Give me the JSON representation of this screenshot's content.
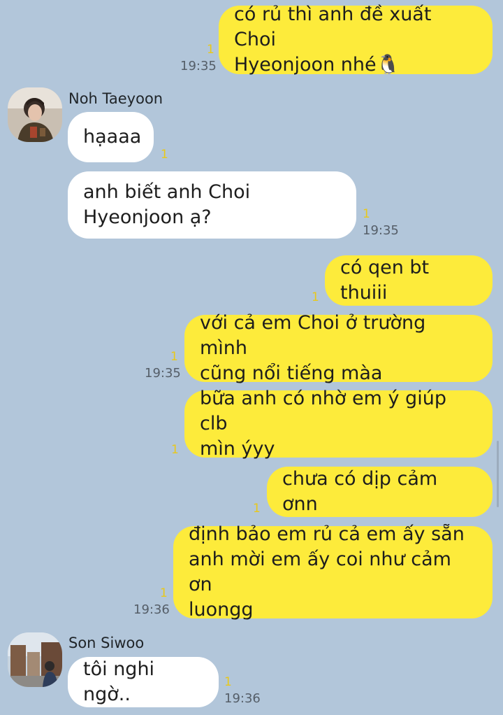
{
  "colors": {
    "background": "#b2c6da",
    "outgoing_bubble": "#fdeb3b",
    "incoming_bubble": "#ffffff",
    "read_count": "#e8c81a"
  },
  "messages": [
    {
      "text": "có rủ thì anh đề xuất Choi\nHyeonjoon nhé🐧",
      "read": "1",
      "time": "19:35"
    },
    {
      "sender": "Noh Taeyoon",
      "text": "hạaaa",
      "read": "1",
      "time": ""
    },
    {
      "text": "anh biết anh Choi\nHyeonjoon ạ?",
      "read": "1",
      "time": "19:35"
    },
    {
      "text": "có qen bt thuiii",
      "read": "1",
      "time": ""
    },
    {
      "text": "với cả em Choi ở trường mình\ncũng nổi tiếng màa",
      "read": "1",
      "time": "19:35"
    },
    {
      "text": "bữa anh có nhờ em ý giúp clb\nmìn ýyy",
      "read": "1",
      "time": ""
    },
    {
      "text": "chưa có dịp cảm ơnn",
      "read": "1",
      "time": ""
    },
    {
      "text": "định bảo em rủ cả em ấy sẵn\nanh mời em ấy coi như cảm ơn\nluongg",
      "read": "1",
      "time": "19:36"
    },
    {
      "sender": "Son Siwoo",
      "text": "tôi nghi ngờ..",
      "read": "1",
      "time": "19:36"
    }
  ]
}
